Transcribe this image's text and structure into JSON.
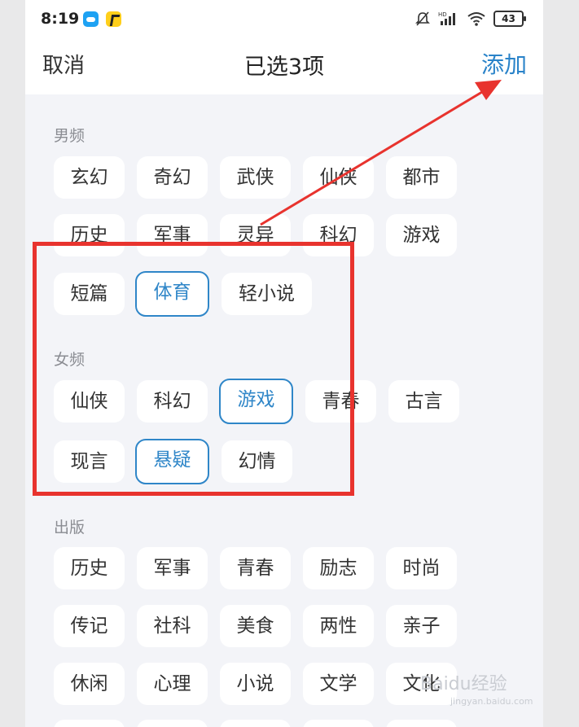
{
  "status": {
    "time": "8:19",
    "battery": "43",
    "network_label": "HD"
  },
  "nav": {
    "cancel": "取消",
    "title": "已选3项",
    "add": "添加"
  },
  "sections": [
    {
      "label": "男频",
      "chips": [
        "玄幻",
        "奇幻",
        "武侠",
        "仙侠",
        "都市",
        "历史",
        "军事",
        "灵异",
        "科幻",
        "游戏",
        "短篇",
        "体育",
        "轻小说"
      ],
      "selected": [
        "体育"
      ]
    },
    {
      "label": "女频",
      "chips": [
        "仙侠",
        "科幻",
        "游戏",
        "青春",
        "古言",
        "现言",
        "悬疑",
        "幻情"
      ],
      "selected": [
        "游戏",
        "悬疑"
      ]
    },
    {
      "label": "出版",
      "chips": [
        "历史",
        "军事",
        "青春",
        "励志",
        "时尚",
        "传记",
        "社科",
        "美食",
        "两性",
        "亲子",
        "休闲",
        "心理",
        "小说",
        "文学",
        "文化"
      ],
      "selected": []
    }
  ],
  "watermark": {
    "brand": "Baidu经验",
    "url": "jingyan.baidu.com"
  },
  "colors": {
    "accent": "#2f86c8",
    "annotation": "#e8332e",
    "background": "#f3f4f8"
  }
}
